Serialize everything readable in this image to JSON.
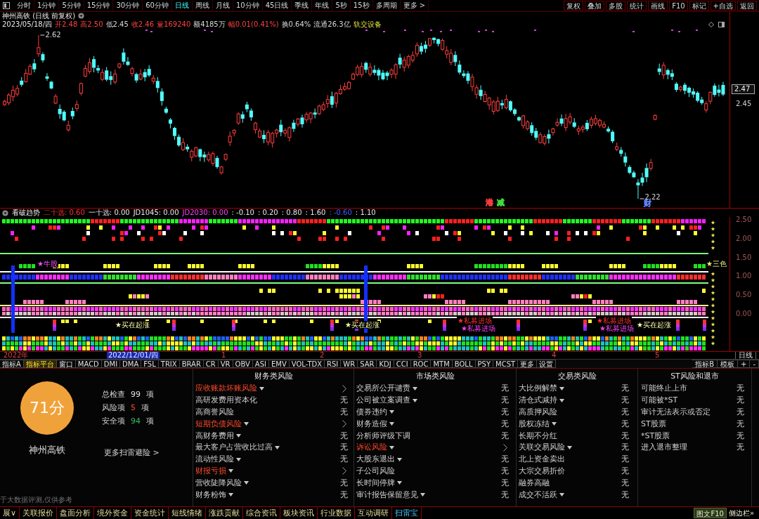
{
  "toolbar": {
    "periods": [
      {
        "label": "分时",
        "selected": false
      },
      {
        "label": "1分钟",
        "selected": false
      },
      {
        "label": "5分钟",
        "selected": false
      },
      {
        "label": "15分钟",
        "selected": false
      },
      {
        "label": "30分钟",
        "selected": false
      },
      {
        "label": "60分钟",
        "selected": false
      },
      {
        "label": "日线",
        "selected": true
      },
      {
        "label": "周线",
        "selected": false
      },
      {
        "label": "月线",
        "selected": false
      },
      {
        "label": "10分钟",
        "selected": false
      },
      {
        "label": "45日线",
        "selected": false
      },
      {
        "label": "季线",
        "selected": false
      },
      {
        "label": "年线",
        "selected": false
      },
      {
        "label": "5秒",
        "selected": false
      },
      {
        "label": "15秒",
        "selected": false
      },
      {
        "label": "多周期",
        "selected": false
      },
      {
        "label": "更多 >",
        "selected": false
      }
    ],
    "tools": [
      "复权",
      "叠加",
      "多股",
      "统计",
      "画线",
      "F10",
      "标记",
      "+自选",
      "返回"
    ]
  },
  "quote": {
    "title": "神州高铁 (日线 前复权)",
    "date": "2023/05/18/四",
    "fields": [
      {
        "text": "开2.48",
        "color": "#ff4040"
      },
      {
        "text": "高2.50",
        "color": "#ff4040"
      },
      {
        "text": "低2.45",
        "color": "#d8d8d8"
      },
      {
        "text": "收2.46",
        "color": "#ff4040"
      },
      {
        "text": "量169240",
        "color": "#ff4040"
      },
      {
        "text": "额4185万",
        "color": "#d8d8d8"
      },
      {
        "text": "幅0.01(0.41%)",
        "color": "#ff4040"
      },
      {
        "text": "换0.64%",
        "color": "#d8d8d8"
      },
      {
        "text": "流通26.3亿",
        "color": "#d8d8d8"
      }
    ],
    "sector": "轨交设备"
  },
  "price_chart": {
    "high_label": "2.62",
    "low_label": "2.22",
    "events": [
      {
        "text": "港",
        "color": "#ff4040"
      },
      {
        "text": "减",
        "color": "#40e040"
      },
      {
        "text": "财",
        "color": "#6080ff"
      }
    ],
    "price_tag": "2.47",
    "axis_labels": [
      "2.45"
    ]
  },
  "indicator": {
    "title": "看破趋势",
    "series": [
      {
        "text": "二十选: 0.60",
        "color": "#ff3030"
      },
      {
        "text": "一十选: 0.00",
        "color": "#e8e8e8"
      },
      {
        "text": "JD1045: 0.00",
        "color": "#e8e8e8"
      },
      {
        "text": "JD2030: 0.00",
        "color": "#ff40ff"
      },
      {
        "text": ": -0.10",
        "color": "#e8e8e8"
      },
      {
        "text": ": 0.20",
        "color": "#e8e8e8"
      },
      {
        "text": ": 0.80",
        "color": "#e8e8e8"
      },
      {
        "text": ": 1.60",
        "color": "#e8e8e8"
      },
      {
        "text": ": -0.60",
        "color": "#4060ff"
      },
      {
        "text": ": 1.10",
        "color": "#e8e8e8"
      }
    ],
    "signals": [
      {
        "text": "★牛股",
        "color": "#ff50ff"
      },
      {
        "text": "★买在起涨",
        "color": "#ffffb0"
      },
      {
        "text": "★买在起涨",
        "color": "#ffffb0"
      },
      {
        "text": "★私募进场",
        "color": "#ff3030"
      },
      {
        "text": "★私募进场",
        "color": "#ff40ff"
      },
      {
        "text": "★私募进场",
        "color": "#ff3030"
      },
      {
        "text": "★私募进场",
        "color": "#ff40ff"
      },
      {
        "text": "★买在起涨",
        "color": "#ffffb0"
      },
      {
        "text": "★三色",
        "color": "#f0f080"
      }
    ],
    "axis_labels": [
      "2.50",
      "2.00",
      "1.50",
      "1.00",
      "0.50",
      "0.00"
    ]
  },
  "time_axis": {
    "labels": [
      {
        "text": "2022年",
        "selected": false
      },
      {
        "text": "2022/12/01/四",
        "selected": true
      },
      {
        "text": "1",
        "selected": false
      },
      {
        "text": "2",
        "selected": false
      },
      {
        "text": "3",
        "selected": false
      },
      {
        "text": "4",
        "selected": false
      },
      {
        "text": "5",
        "selected": false
      }
    ],
    "period": "日线"
  },
  "indicator_tabs": {
    "left": [
      {
        "label": "指标A",
        "selected": false
      },
      {
        "label": "指标平台",
        "selected": true
      },
      {
        "label": "窗口",
        "selected": false
      },
      {
        "label": "MACD",
        "selected": false
      },
      {
        "label": "DMI",
        "selected": false
      },
      {
        "label": "DMA",
        "selected": false
      },
      {
        "label": "FSL",
        "selected": false
      },
      {
        "label": "TRIX",
        "selected": false
      },
      {
        "label": "BRAR",
        "selected": false
      },
      {
        "label": "CR",
        "selected": false
      },
      {
        "label": "VR",
        "selected": false
      },
      {
        "label": "OBV",
        "selected": false
      },
      {
        "label": "ASI",
        "selected": false
      },
      {
        "label": "EMV",
        "selected": false
      },
      {
        "label": "VOL-TDX",
        "selected": false
      },
      {
        "label": "RSI",
        "selected": false
      },
      {
        "label": "WR",
        "selected": false
      },
      {
        "label": "SAR",
        "selected": false
      },
      {
        "label": "KDJ",
        "selected": false
      },
      {
        "label": "CCI",
        "selected": false
      },
      {
        "label": "ROC",
        "selected": false
      },
      {
        "label": "MTM",
        "selected": false
      },
      {
        "label": "BOLL",
        "selected": false
      },
      {
        "label": "PSY",
        "selected": false
      },
      {
        "label": "MCST",
        "selected": false
      },
      {
        "label": "更多",
        "selected": false
      },
      {
        "label": "设置",
        "selected": false
      }
    ],
    "right": [
      "指标B",
      "模板",
      "+",
      "-"
    ]
  },
  "risk_scan": {
    "score": "71分",
    "stock": "神州高铁",
    "stats": [
      {
        "label": "总检查",
        "value": "99",
        "unit": "项",
        "color": "#e0e0e0"
      },
      {
        "label": "风险项",
        "value": "5",
        "unit": "项",
        "color": "#ff4a2a"
      },
      {
        "label": "安全项",
        "value": "94",
        "unit": "项",
        "color": "#30c060"
      }
    ],
    "more_link": "更多扫雷避险 >",
    "note": "于大数据评测,仅供参考",
    "columns": [
      {
        "title": "财务类风险",
        "items": [
          {
            "label": "应收账款坏账风险",
            "dropdown": true,
            "risk": true
          },
          {
            "label": "高研发费用资本化",
            "dropdown": false,
            "risk": false,
            "result": "无"
          },
          {
            "label": "高商誉风险",
            "dropdown": false,
            "risk": false,
            "result": "无"
          },
          {
            "label": "短期负债风险",
            "dropdown": true,
            "risk": true
          },
          {
            "label": "高财务费用",
            "dropdown": true,
            "risk": false,
            "result": "无"
          },
          {
            "label": "最大客户占营收比过高",
            "dropdown": true,
            "risk": false,
            "result": "无"
          },
          {
            "label": "流动性风险",
            "dropdown": true,
            "risk": false,
            "result": "无"
          },
          {
            "label": "财报亏损",
            "dropdown": true,
            "risk": true
          },
          {
            "label": "营收陡降风险",
            "dropdown": true,
            "risk": false,
            "result": "无"
          },
          {
            "label": "财务粉饰",
            "dropdown": true,
            "risk": false,
            "result": "无"
          }
        ]
      },
      {
        "title": "市场类风险",
        "items": [
          {
            "label": "交易所公开谴责",
            "dropdown": true,
            "risk": false,
            "result": "无"
          },
          {
            "label": "公司被立案调查",
            "dropdown": true,
            "risk": false,
            "result": "无"
          },
          {
            "label": "债券违约",
            "dropdown": true,
            "risk": false,
            "result": "无"
          },
          {
            "label": "财务造假",
            "dropdown": true,
            "risk": false,
            "result": "无"
          },
          {
            "label": "分析师评级下调",
            "dropdown": false,
            "risk": false,
            "result": "无"
          },
          {
            "label": "诉讼风险",
            "dropdown": true,
            "risk": true
          },
          {
            "label": "大股东退出",
            "dropdown": true,
            "risk": false,
            "result": "无"
          },
          {
            "label": "子公司风险",
            "dropdown": false,
            "risk": false,
            "result": "无"
          },
          {
            "label": "长时间停牌",
            "dropdown": true,
            "risk": false,
            "result": "无"
          },
          {
            "label": "审计报告保留意见",
            "dropdown": true,
            "risk": false,
            "result": "无"
          }
        ]
      },
      {
        "title": "交易类风险",
        "items": [
          {
            "label": "大比例解禁",
            "dropdown": true,
            "risk": false,
            "result": "无"
          },
          {
            "label": "清仓式减持",
            "dropdown": true,
            "risk": false,
            "result": "无"
          },
          {
            "label": "高质押风险",
            "dropdown": false,
            "risk": false,
            "result": "无"
          },
          {
            "label": "股权冻结",
            "dropdown": true,
            "risk": false,
            "result": "无"
          },
          {
            "label": "长期不分红",
            "dropdown": false,
            "risk": false,
            "result": "无"
          },
          {
            "label": "关联交易风险",
            "dropdown": true,
            "risk": false,
            "result": "无"
          },
          {
            "label": "北上资金卖出",
            "dropdown": false,
            "risk": false,
            "result": "无"
          },
          {
            "label": "大宗交易折价",
            "dropdown": false,
            "risk": false,
            "result": "无"
          },
          {
            "label": "融券高融",
            "dropdown": false,
            "risk": false,
            "result": "无"
          },
          {
            "label": "成交不活跃",
            "dropdown": true,
            "risk": false,
            "result": "无"
          }
        ]
      },
      {
        "title": "ST风险和退市",
        "items": [
          {
            "label": "可能终止上市",
            "dropdown": false,
            "risk": false,
            "result": "无"
          },
          {
            "label": "可能被*ST",
            "dropdown": false,
            "risk": false,
            "result": "无"
          },
          {
            "label": "审计无法表示或否定",
            "dropdown": false,
            "risk": false,
            "result": "无"
          },
          {
            "label": "ST股票",
            "dropdown": false,
            "risk": false,
            "result": "无"
          },
          {
            "label": "*ST股票",
            "dropdown": false,
            "risk": false,
            "result": "无"
          },
          {
            "label": "进入退市整理",
            "dropdown": false,
            "risk": false,
            "result": "无"
          }
        ]
      }
    ]
  },
  "status_bar": {
    "tabs": [
      {
        "label": "展∨",
        "selected": false
      },
      {
        "label": "关联报价",
        "selected": false
      },
      {
        "label": "盘面分析",
        "selected": false
      },
      {
        "label": "境外资金",
        "selected": false
      },
      {
        "label": "资金统计",
        "selected": false
      },
      {
        "label": "短线情绪",
        "selected": false
      },
      {
        "label": "涨跌贡献",
        "selected": false
      },
      {
        "label": "综合资讯",
        "selected": false
      },
      {
        "label": "板块资讯",
        "selected": false
      },
      {
        "label": "行业数据",
        "selected": false
      },
      {
        "label": "互动调研",
        "selected": false
      },
      {
        "label": "扫雷宝",
        "selected": true
      }
    ],
    "right": [
      "图文F10",
      "侧边栏»"
    ]
  }
}
